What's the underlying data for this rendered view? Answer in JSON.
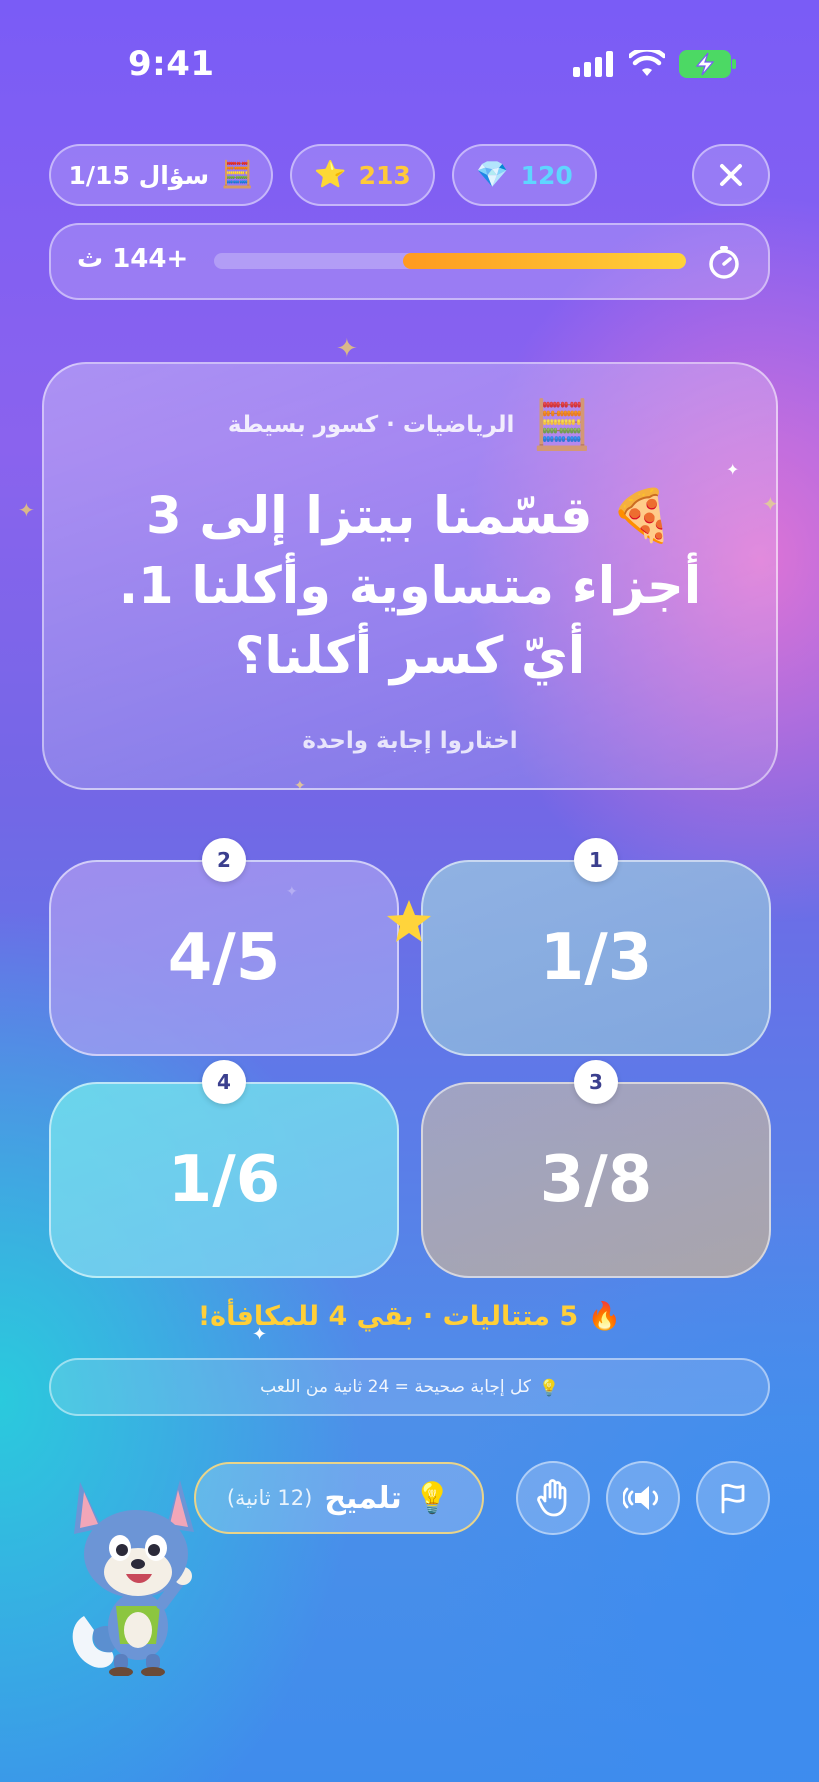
{
  "status_bar": {
    "time": "9:41"
  },
  "header": {
    "close_icon": "✕",
    "gems": {
      "value": "120",
      "icon": "💎"
    },
    "stars": {
      "value": "213",
      "icon": "⭐"
    },
    "question_counter": {
      "label": "سؤال 1/15",
      "icon": "🧮"
    }
  },
  "timer": {
    "bonus_text": "+144 ث",
    "progress_remaining": 0.6,
    "icon": "timer-icon"
  },
  "question": {
    "subject": "الرياضيات · كسور بسيطة",
    "subject_icon": "🧮",
    "text": "🍕 قسّمنا بيتزا إلى 3 أجزاء متساوية وأكلنا 1. أيّ كسر أكلنا؟",
    "instruction": "اختاروا إجابة واحدة"
  },
  "answers": [
    {
      "number": "1",
      "value": "1/3"
    },
    {
      "number": "2",
      "value": "4/5"
    },
    {
      "number": "3",
      "value": "3/8"
    },
    {
      "number": "4",
      "value": "1/6"
    }
  ],
  "streak": {
    "text": "🔥 5 متتاليات · بقي 4 للمكافأة!"
  },
  "info": {
    "text": "كل إجابة صحيحة = 24 ثانية من اللعب",
    "icon": "💡"
  },
  "controls": {
    "hint_label": "تلميح",
    "hint_sub": "(12 ثانية)",
    "hint_icon": "💡"
  },
  "colors": {
    "accent_gold": "#ffcf38",
    "timer_fill": "#ffb52a",
    "gem_blue": "#5fd5ff"
  }
}
